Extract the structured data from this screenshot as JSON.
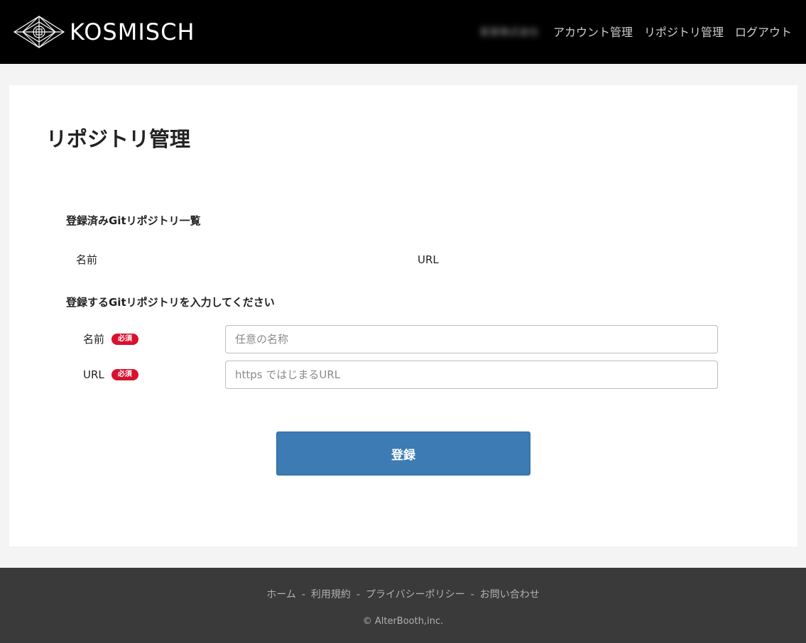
{
  "header": {
    "logo_text": "KOSMISCH",
    "user_name": "某某株式会社",
    "nav": {
      "account": "アカウント管理",
      "repository": "リポジトリ管理",
      "logout": "ログアウト"
    }
  },
  "main": {
    "page_title": "リポジトリ管理",
    "registered_title": "登録済みGitリポジトリ一覧",
    "columns": [
      "名前",
      "URL"
    ],
    "form_title": "登録するGitリポジトリを入力してください",
    "fields": [
      {
        "label": "名前",
        "badge": "必須",
        "placeholder": "任意の名称",
        "value": ""
      },
      {
        "label": "URL",
        "badge": "必須",
        "placeholder": "https ではじまるURL",
        "value": ""
      }
    ],
    "submit_label": "登録"
  },
  "footer": {
    "links": [
      "ホーム",
      "利用規約",
      "プライバシーポリシー",
      "お問い合わせ"
    ],
    "separator": "-",
    "copyright": "© AlterBooth,inc."
  },
  "colors": {
    "header_bg": "#000000",
    "badge": "#d9112f",
    "button": "#3c7bb3",
    "footer_bg": "#3a3a3a"
  }
}
